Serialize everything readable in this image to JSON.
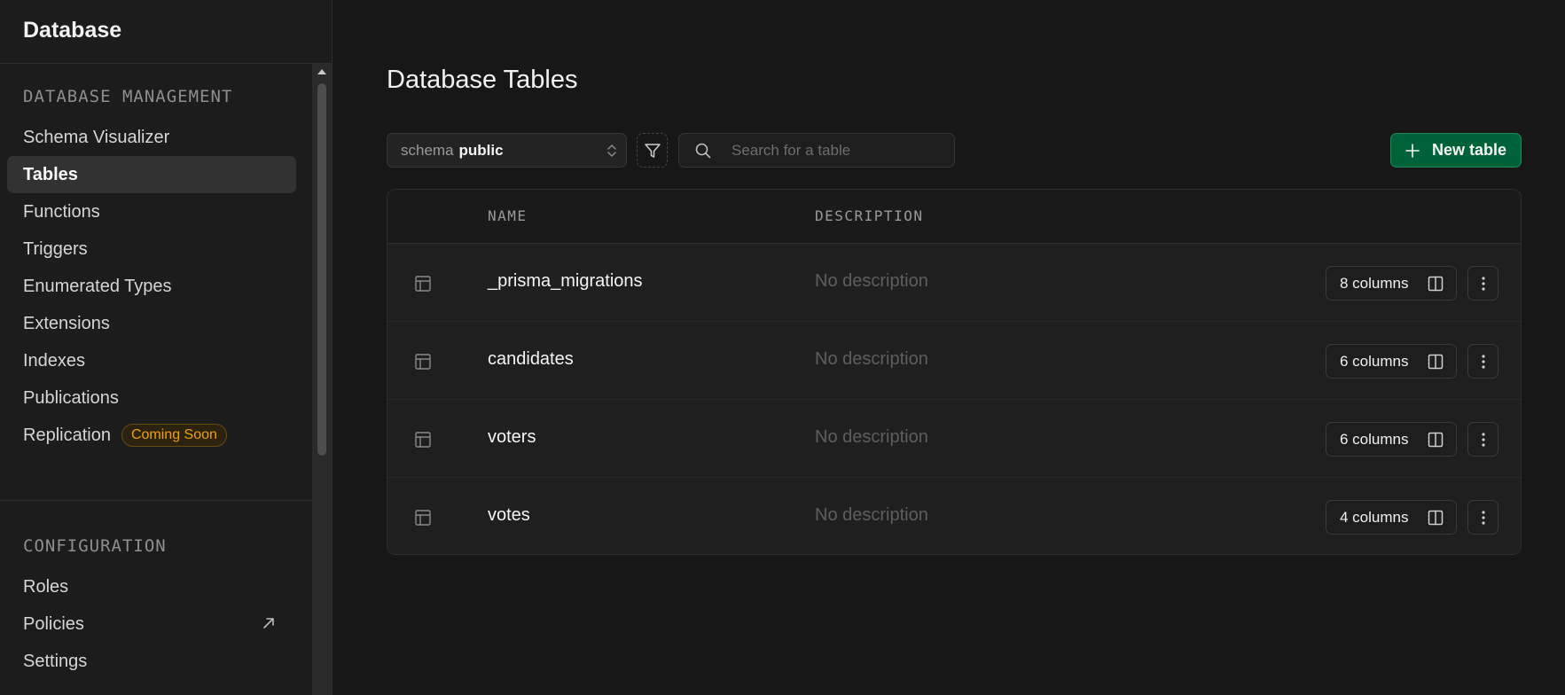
{
  "sidebar": {
    "title": "Database",
    "sections": [
      {
        "heading": "DATABASE MANAGEMENT",
        "items": [
          {
            "label": "Schema Visualizer"
          },
          {
            "label": "Tables",
            "active": true
          },
          {
            "label": "Functions"
          },
          {
            "label": "Triggers"
          },
          {
            "label": "Enumerated Types"
          },
          {
            "label": "Extensions"
          },
          {
            "label": "Indexes"
          },
          {
            "label": "Publications"
          },
          {
            "label": "Replication",
            "badge": "Coming Soon"
          }
        ]
      },
      {
        "heading": "CONFIGURATION",
        "items": [
          {
            "label": "Roles"
          },
          {
            "label": "Policies",
            "external": true
          },
          {
            "label": "Settings"
          }
        ]
      }
    ]
  },
  "main": {
    "title": "Database Tables",
    "schema": {
      "label": "schema",
      "value": "public"
    },
    "search": {
      "placeholder": "Search for a table",
      "value": ""
    },
    "new_table_label": "New table",
    "columns": {
      "name": "NAME",
      "description": "DESCRIPTION"
    },
    "rows": [
      {
        "name": "_prisma_migrations",
        "description": "No description",
        "columns_label": "8 columns"
      },
      {
        "name": "candidates",
        "description": "No description",
        "columns_label": "6 columns"
      },
      {
        "name": "voters",
        "description": "No description",
        "columns_label": "6 columns"
      },
      {
        "name": "votes",
        "description": "No description",
        "columns_label": "4 columns"
      }
    ]
  },
  "colors": {
    "accent": "#006239",
    "badge": "#f1a10d",
    "background": "#171717"
  }
}
